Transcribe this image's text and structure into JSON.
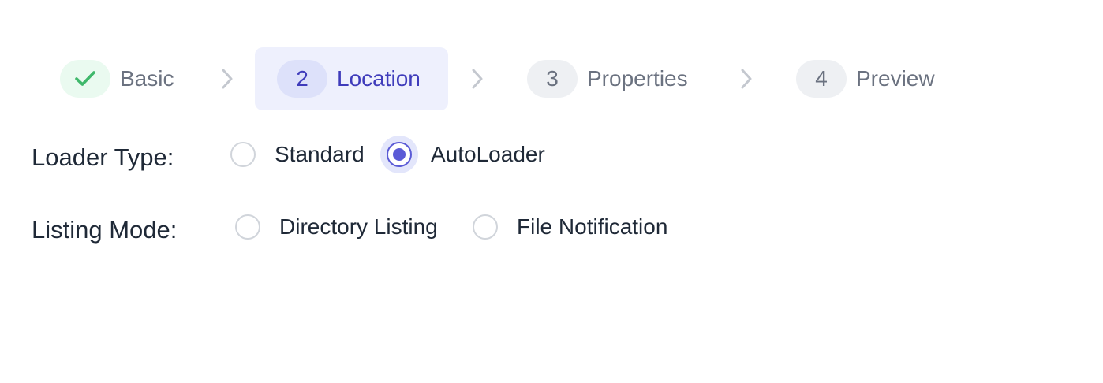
{
  "stepper": {
    "steps": [
      {
        "number": "",
        "label": "Basic",
        "state": "completed",
        "icon": "check-icon"
      },
      {
        "number": "2",
        "label": "Location",
        "state": "active"
      },
      {
        "number": "3",
        "label": "Properties",
        "state": "upcoming"
      },
      {
        "number": "4",
        "label": "Preview",
        "state": "upcoming"
      }
    ],
    "separator_icon": "chevron-right-icon"
  },
  "form": {
    "loader_type": {
      "label": "Loader Type:",
      "options": [
        "Standard",
        "AutoLoader"
      ],
      "selected": "AutoLoader"
    },
    "listing_mode": {
      "label": "Listing Mode:",
      "options": [
        "Directory Listing",
        "File Notification"
      ],
      "selected": ""
    }
  },
  "colors": {
    "accent": "#5b5bd6",
    "active_step_bg": "#eef0fd",
    "active_text": "#3f3cbb",
    "completed_green": "#3fb86b",
    "muted_text": "#6b7280",
    "radio_border": "#d1d5db"
  }
}
